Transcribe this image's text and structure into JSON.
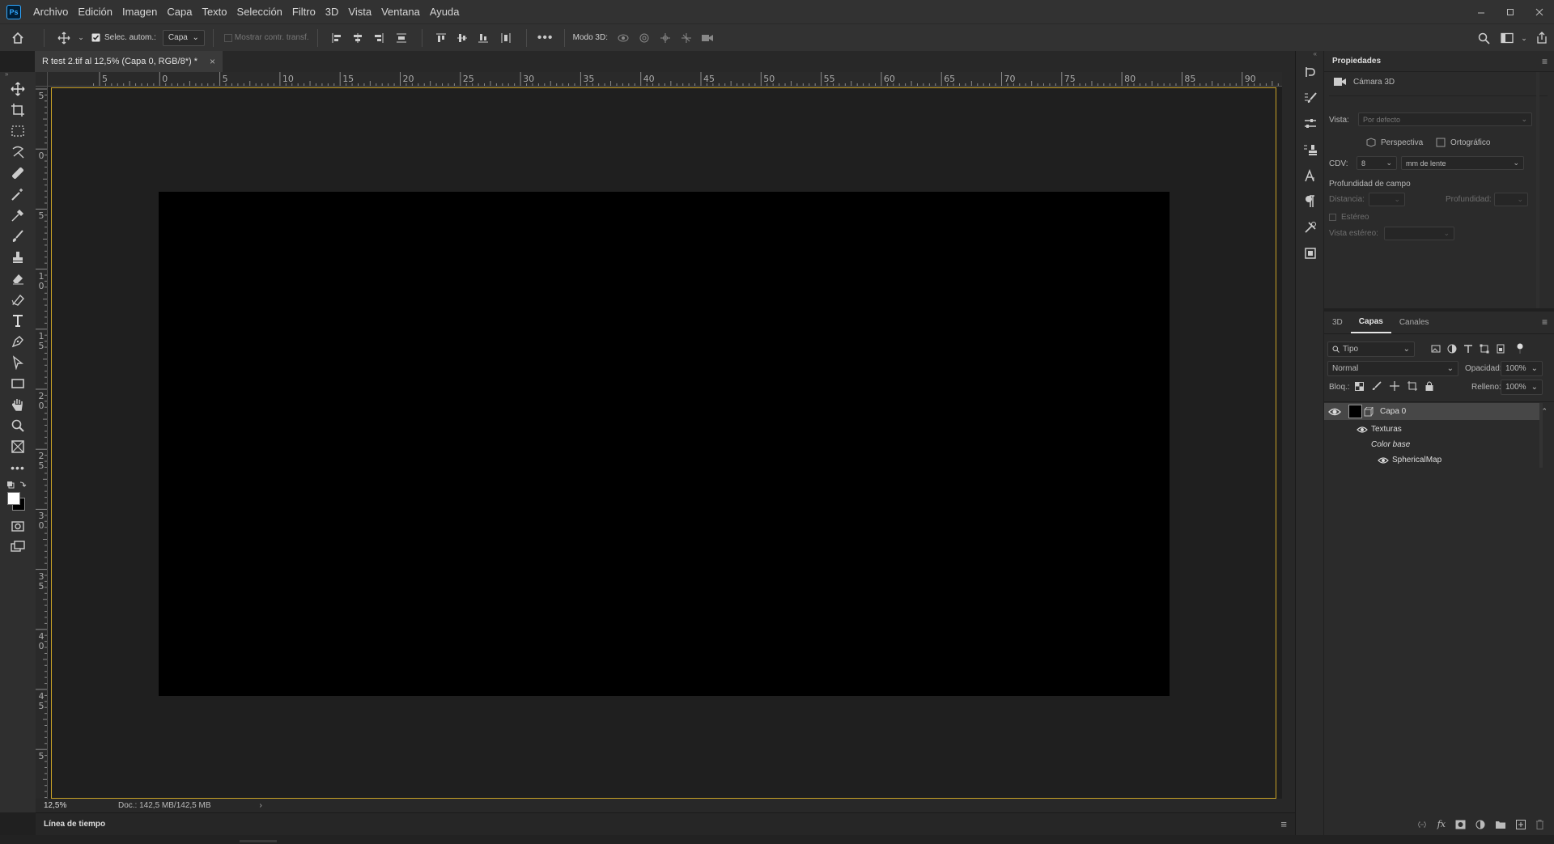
{
  "app": {
    "logo": "Ps"
  },
  "menu": [
    "Archivo",
    "Edición",
    "Imagen",
    "Capa",
    "Texto",
    "Selección",
    "Filtro",
    "3D",
    "Vista",
    "Ventana",
    "Ayuda"
  ],
  "options_bar": {
    "auto_select_label": "Selec. autom.:",
    "auto_select_target": "Capa",
    "show_transform_label": "Mostrar contr. transf.",
    "mode_3d_label": "Modo 3D:"
  },
  "document": {
    "tab_title": "R test 2.tif al 12,5% (Capa 0, RGB/8*) *",
    "close_glyph": "×",
    "zoom": "12,5%",
    "doc_info": "Doc.: 142,5 MB/142,5 MB",
    "ruler_top": [
      "5",
      "0",
      "5",
      "10",
      "15",
      "20",
      "25",
      "30",
      "35",
      "40",
      "45",
      "50",
      "55",
      "60",
      "65",
      "70",
      "75",
      "80",
      "85",
      "90"
    ],
    "ruler_left": [
      "5",
      "0",
      "5",
      "1 0",
      "1 5",
      "2 0",
      "2 5",
      "3 0",
      "3 5",
      "4 0",
      "4 5",
      "5"
    ]
  },
  "timeline": {
    "label": "Línea de tiempo"
  },
  "properties": {
    "title": "Propiedades",
    "camera_label": "Cámara 3D",
    "view_label": "Vista:",
    "view_value": "Por defecto",
    "perspective": "Perspectiva",
    "orthographic": "Ortográfico",
    "fov_label": "CDV:",
    "fov_value": "8",
    "fov_unit": "mm de lente",
    "dof_label": "Profundidad de campo",
    "distance_label": "Distancia:",
    "depth_label": "Profundidad:",
    "stereo_label": "Estéreo",
    "stereo_view_label": "Vista estéreo:"
  },
  "layers_panel": {
    "tabs": [
      "3D",
      "Capas",
      "Canales"
    ],
    "active_tab": "Capas",
    "filter_label": "Tipo",
    "blend_mode": "Normal",
    "opacity_label": "Opacidad:",
    "opacity_value": "100%",
    "lock_label": "Bloq.:",
    "fill_label": "Relleno:",
    "fill_value": "100%",
    "layers": [
      {
        "name": "Capa 0"
      },
      {
        "name": "Texturas"
      },
      {
        "name": "Color base"
      },
      {
        "name": "SphericalMap"
      }
    ]
  },
  "colors": {
    "accent_border": "#c9a227",
    "canvas_bg": "#1e1e1e",
    "image": "#000000"
  }
}
